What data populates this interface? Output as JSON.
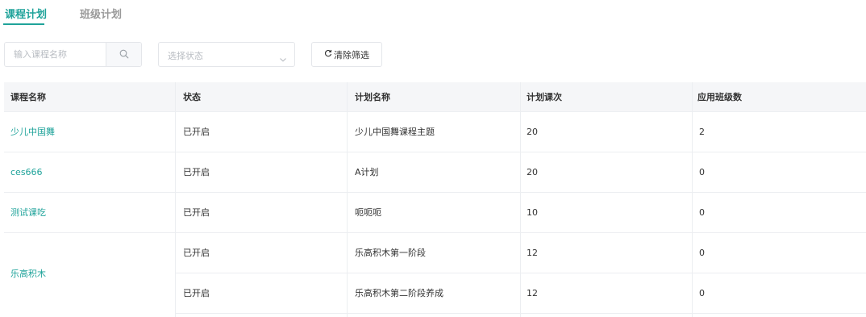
{
  "tabs": [
    {
      "label": "课程计划",
      "active": true
    },
    {
      "label": "班级计划",
      "active": false
    }
  ],
  "filters": {
    "search_placeholder": "输入课程名称",
    "status_placeholder": "选择状态",
    "clear_label": "清除筛选"
  },
  "table": {
    "columns": [
      "课程名称",
      "状态",
      "计划名称",
      "计划课次",
      "应用班级数"
    ],
    "rows": [
      {
        "course": "少儿中国舞",
        "status": "已开启",
        "plan": "少儿中国舞课程主题",
        "sessions": "20",
        "classes": "2"
      },
      {
        "course": "ces666",
        "status": "已开启",
        "plan": "A计划",
        "sessions": "20",
        "classes": "0"
      },
      {
        "course": "测试课吃",
        "status": "已开启",
        "plan": "呃呃呃",
        "sessions": "10",
        "classes": "0"
      },
      {
        "course": "乐高积木",
        "status": "已开启",
        "plan": "乐高积木第一阶段",
        "sessions": "12",
        "classes": "0"
      },
      {
        "course": "",
        "status": "已开启",
        "plan": "乐高积木第二阶段养成",
        "sessions": "12",
        "classes": "0"
      }
    ]
  },
  "colors": {
    "accent": "#1fa39a",
    "header_bg": "#f5f6f8",
    "border": "#eceef1"
  }
}
